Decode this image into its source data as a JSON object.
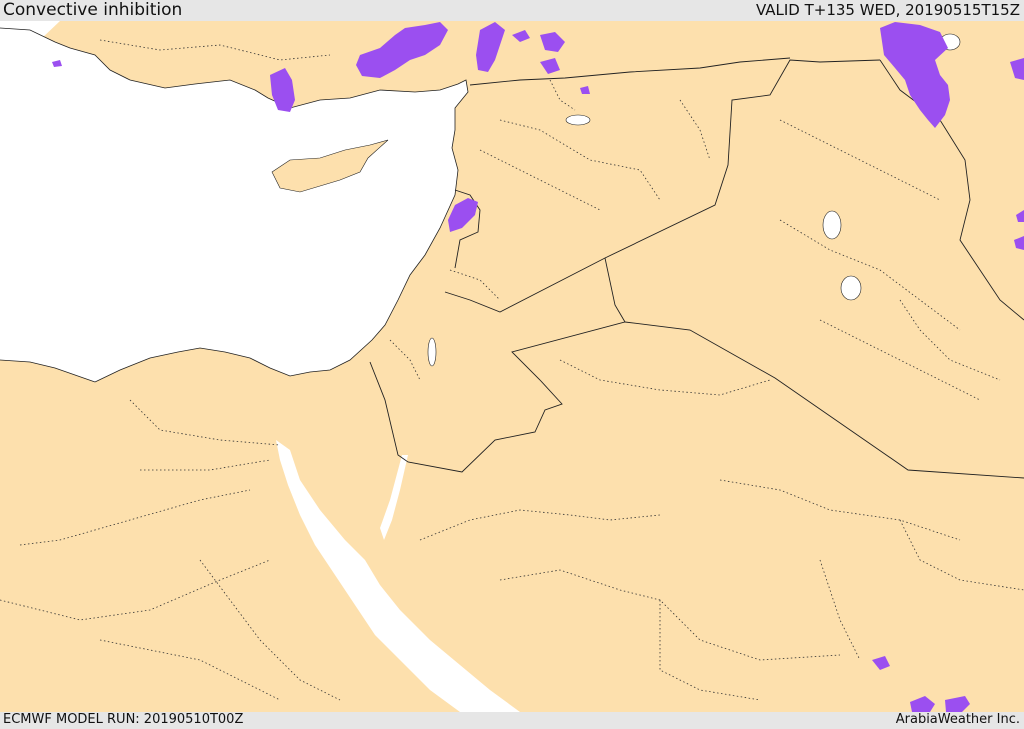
{
  "header": {
    "title": "Convective inhibition",
    "valid": "VALID T+135 WED, 20190515T15Z"
  },
  "footer": {
    "model_run": "ECMWF MODEL RUN: 20190510T00Z",
    "credit": "ArabiaWeather Inc."
  },
  "colors": {
    "land": "#fde0ad",
    "sea": "#ffffff",
    "cin_fill": "#9b4ff0",
    "border": "#222222",
    "bar": "#e6e6e6"
  }
}
